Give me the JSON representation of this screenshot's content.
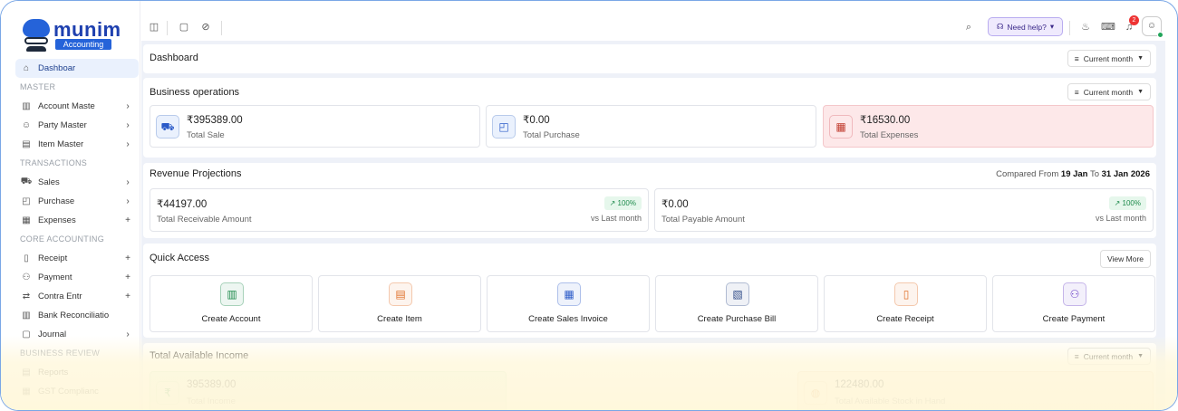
{
  "brand": {
    "name": "munim",
    "sub": "Accounting"
  },
  "sidebar": {
    "dashboard": "Dashboar",
    "sections": {
      "master": "MASTER",
      "transactions": "TRANSACTIONS",
      "core": "CORE ACCOUNTING",
      "review": "BUSINESS REVIEW"
    },
    "master_items": [
      {
        "label": "Account Maste",
        "icon": "building-icon"
      },
      {
        "label": "Party Master",
        "icon": "users-icon"
      },
      {
        "label": "Item Master",
        "icon": "box-icon"
      }
    ],
    "transaction_items": [
      {
        "label": "Sales",
        "icon": "cart-icon"
      },
      {
        "label": "Purchase",
        "icon": "bag-icon"
      },
      {
        "label": "Expenses",
        "icon": "expense-icon"
      }
    ],
    "core_items": [
      {
        "label": "Receipt",
        "icon": "receipt-icon"
      },
      {
        "label": "Payment",
        "icon": "payment-icon"
      },
      {
        "label": "Contra Entr",
        "icon": "contra-icon"
      },
      {
        "label": "Bank Reconciliatio",
        "icon": "bank-icon"
      },
      {
        "label": "Journal",
        "icon": "journal-icon"
      }
    ],
    "review_items": [
      {
        "label": "Reports",
        "icon": "report-icon"
      },
      {
        "label": "GST Complianc",
        "icon": "gst-icon"
      }
    ]
  },
  "topbar": {
    "help": "Need help?",
    "notifications": "2"
  },
  "dashboard": {
    "title": "Dashboard",
    "period": "Current month"
  },
  "business": {
    "title": "Business operations",
    "period": "Current month",
    "total_sale": {
      "value": "₹395389.00",
      "label": "Total Sale"
    },
    "total_purchase": {
      "value": "₹0.00",
      "label": "Total Purchase"
    },
    "total_expenses": {
      "value": "₹16530.00",
      "label": "Total Expenses"
    }
  },
  "revenue": {
    "title": "Revenue Projections",
    "compared_prefix": "Compared From",
    "from": "19 Jan",
    "to_word": "To",
    "to": "31 Jan 2026",
    "receivable": {
      "value": "₹44197.00",
      "label": "Total Receivable Amount",
      "change": "100%",
      "vs": "vs Last month"
    },
    "payable": {
      "value": "₹0.00",
      "label": "Total Payable Amount",
      "change": "100%",
      "vs": "vs Last month"
    }
  },
  "quick": {
    "title": "Quick Access",
    "view_more": "View More",
    "items": [
      {
        "label": "Create Account",
        "icon": "account-icon",
        "color": "#1d8a4b"
      },
      {
        "label": "Create Item",
        "icon": "item-icon",
        "color": "#e0702a"
      },
      {
        "label": "Create Sales Invoice",
        "icon": "invoice-icon",
        "color": "#2a5ac8"
      },
      {
        "label": "Create Purchase Bill",
        "icon": "bill-icon",
        "color": "#334e8a"
      },
      {
        "label": "Create Receipt",
        "icon": "receipt-icon",
        "color": "#e0702a"
      },
      {
        "label": "Create Payment",
        "icon": "payment-icon",
        "color": "#6a3fc7"
      }
    ]
  },
  "income": {
    "title": "Total Available Income",
    "period": "Current month",
    "total": {
      "value": "395389.00",
      "label": "Total Income"
    },
    "stock": {
      "value": "122480.00",
      "label": "Total Available Stock in Hand"
    }
  }
}
